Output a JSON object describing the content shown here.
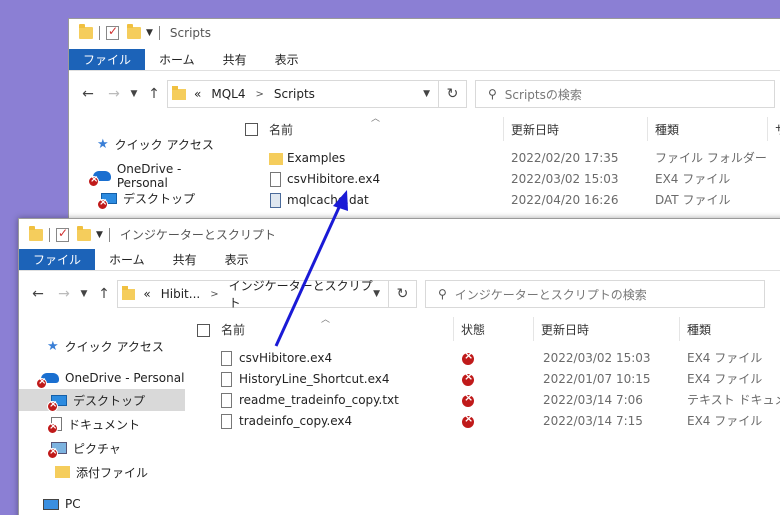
{
  "back_window": {
    "title": "Scripts",
    "ribbon_tabs": [
      "ファイル",
      "ホーム",
      "共有",
      "表示"
    ],
    "breadcrumb": [
      "«",
      "MQL4",
      "Scripts"
    ],
    "search_placeholder": "Scriptsの検索",
    "nav": [
      {
        "label": "クイック アクセス",
        "icon": "star-icon"
      },
      {
        "label": "OneDrive - Personal",
        "icon": "onedrive-cloud-icon"
      },
      {
        "label": "デスクトップ",
        "icon": "desktop-icon"
      }
    ],
    "columns": [
      "名前",
      "更新日時",
      "種類",
      "サ"
    ],
    "files": [
      {
        "name": "Examples",
        "date": "2022/02/20 17:35",
        "type": "ファイル フォルダー",
        "icon": "folder-icon"
      },
      {
        "name": "csvHibitore.ex4",
        "date": "2022/03/02 15:03",
        "type": "EX4 ファイル",
        "icon": "file-icon"
      },
      {
        "name": "mqlcache.dat",
        "date": "2022/04/20 16:26",
        "type": "DAT ファイル",
        "icon": "dat-file-icon"
      }
    ]
  },
  "front_window": {
    "title": "インジケーターとスクリプト",
    "ribbon_tabs": [
      "ファイル",
      "ホーム",
      "共有",
      "表示"
    ],
    "breadcrumb": [
      "«",
      "Hibit...",
      "インジケーターとスクリプト"
    ],
    "search_placeholder": "インジケーターとスクリプトの検索",
    "nav": [
      {
        "label": "クイック アクセス",
        "icon": "star-icon"
      },
      {
        "label": "OneDrive - Personal",
        "icon": "onedrive-cloud-icon"
      },
      {
        "label": "デスクトップ",
        "icon": "desktop-icon"
      },
      {
        "label": "ドキュメント",
        "icon": "documents-icon"
      },
      {
        "label": "ピクチャ",
        "icon": "pictures-icon"
      },
      {
        "label": "添付ファイル",
        "icon": "folder-icon"
      },
      {
        "label": "PC",
        "icon": "pc-icon"
      }
    ],
    "columns": [
      "名前",
      "状態",
      "更新日時",
      "種類"
    ],
    "files": [
      {
        "name": "csvHibitore.ex4",
        "date": "2022/03/02 15:03",
        "type": "EX4 ファイル",
        "status": "sync-error-icon"
      },
      {
        "name": "HistoryLine_Shortcut.ex4",
        "date": "2022/01/07 10:15",
        "type": "EX4 ファイル",
        "status": "sync-error-icon"
      },
      {
        "name": "readme_tradeinfo_copy.txt",
        "date": "2022/03/14 7:06",
        "type": "テキスト ドキュメント",
        "status": "sync-error-icon"
      },
      {
        "name": "tradeinfo_copy.ex4",
        "date": "2022/03/14 7:15",
        "type": "EX4 ファイル",
        "status": "sync-error-icon"
      }
    ]
  },
  "colors": {
    "desktop_bg": "#8b7fd4",
    "ribbon_file_tab": "#1c63b8",
    "arrow": "#1a1ad6",
    "sync_error": "#c01a1a",
    "folder": "#f5cd5c"
  }
}
